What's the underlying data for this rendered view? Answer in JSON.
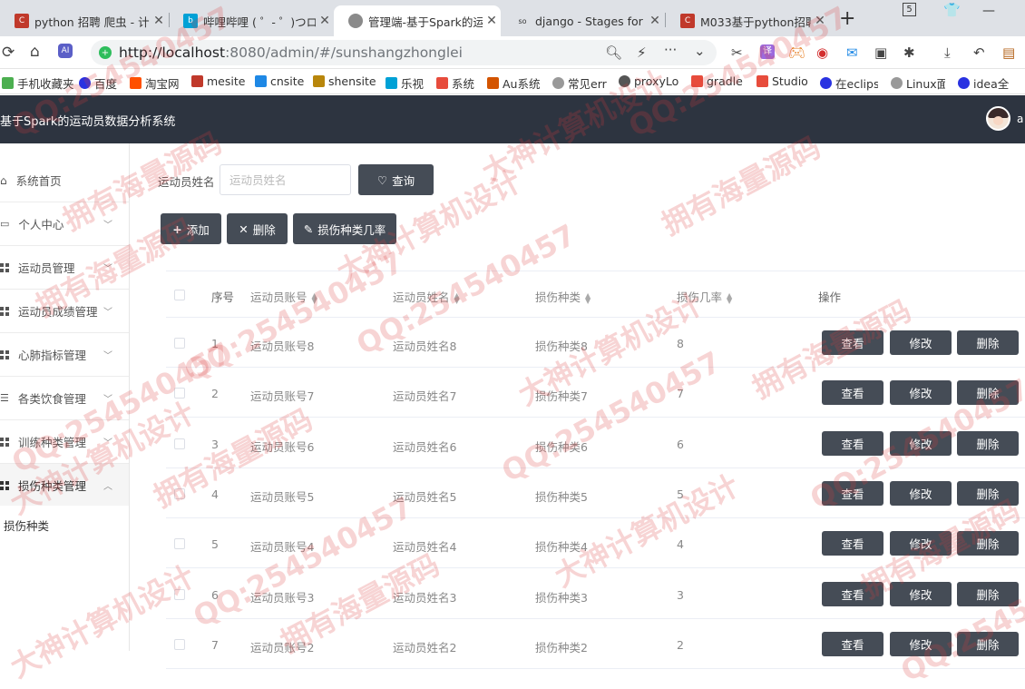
{
  "browser": {
    "tabs": [
      {
        "title": "python 招聘 爬虫 - 计",
        "color": "#c0392b",
        "icon": "csdn-favicon-icon"
      },
      {
        "title": "哔哩哔哩 ( ゜- ゜)つロ",
        "color": "#00a1d6",
        "icon": "bilibili-favicon-icon"
      },
      {
        "title": "管理端-基于Spark的运",
        "color": "#888888",
        "icon": "globe-favicon-icon"
      },
      {
        "title": "django - Stages for /",
        "color": "#333333",
        "icon": "so-favicon-icon"
      },
      {
        "title": "M033基于python招聘",
        "color": "#c0392b",
        "icon": "csdn-favicon-icon"
      }
    ],
    "new_tab_label": "+",
    "window_badge": "5",
    "url_host": "http://localhost",
    "url_path": ":8080/admin/#/sunshangzhonglei",
    "bookmarks": [
      {
        "label": "手机收藏夹",
        "color": "#4caf50"
      },
      {
        "label": "百度",
        "color": "#2932e1"
      },
      {
        "label": "淘宝网",
        "color": "#ff5000"
      },
      {
        "label": "mesite",
        "color": "#c0392b"
      },
      {
        "label": "cnsite",
        "color": "#1e88e5"
      },
      {
        "label": "shensite",
        "color": "#b8860b"
      },
      {
        "label": "乐视",
        "color": "#00a1d6"
      },
      {
        "label": "系统",
        "color": "#e74c3c"
      },
      {
        "label": "Au系统",
        "color": "#d35400"
      },
      {
        "label": "常见err",
        "color": "#999999"
      },
      {
        "label": "proxyLo",
        "color": "#555555"
      },
      {
        "label": "gradle",
        "color": "#e74c3c"
      },
      {
        "label": "Studio",
        "color": "#e74c3c"
      },
      {
        "label": "在eclips",
        "color": "#2932e1"
      },
      {
        "label": "Linux面",
        "color": "#999999"
      },
      {
        "label": "idea全",
        "color": "#2932e1"
      }
    ]
  },
  "app": {
    "title": "基于Spark的运动员数据分析系统",
    "user_initial": "a"
  },
  "sidebar": {
    "items": [
      {
        "label": "系统首页",
        "icon": "home-icon"
      },
      {
        "label": "个人中心",
        "icon": "user-card-icon"
      },
      {
        "label": "运动员管理",
        "icon": "grid-icon"
      },
      {
        "label": "运动员成绩管理",
        "icon": "grid-icon"
      },
      {
        "label": "心肺指标管理",
        "icon": "grid-icon"
      },
      {
        "label": "各类饮食管理",
        "icon": "sliders-icon"
      },
      {
        "label": "训练种类管理",
        "icon": "grid-icon"
      },
      {
        "label": "损伤种类管理",
        "icon": "grid-icon"
      }
    ],
    "submenu": "损伤种类"
  },
  "search": {
    "label": "运动员姓名",
    "placeholder": "运动员姓名",
    "button": "查询"
  },
  "toolbar": {
    "add": "添加",
    "delete": "删除",
    "rate": "损伤种类几率"
  },
  "table": {
    "headers": {
      "index": "序号",
      "account": "运动员账号",
      "name": "运动员姓名",
      "injury": "损伤种类",
      "rate": "损伤几率",
      "ops": "操作"
    },
    "actions": {
      "view": "查看",
      "edit": "修改",
      "delete": "删除"
    },
    "rows": [
      {
        "index": "1",
        "account": "运动员账号8",
        "name": "运动员姓名8",
        "injury": "损伤种类8",
        "rate": "8"
      },
      {
        "index": "2",
        "account": "运动员账号7",
        "name": "运动员姓名7",
        "injury": "损伤种类7",
        "rate": "7"
      },
      {
        "index": "3",
        "account": "运动员账号6",
        "name": "运动员姓名6",
        "injury": "损伤种类6",
        "rate": "6"
      },
      {
        "index": "4",
        "account": "运动员账号5",
        "name": "运动员姓名5",
        "injury": "损伤种类5",
        "rate": "5"
      },
      {
        "index": "5",
        "account": "运动员账号4",
        "name": "运动员姓名4",
        "injury": "损伤种类4",
        "rate": "4"
      },
      {
        "index": "6",
        "account": "运动员账号3",
        "name": "运动员姓名3",
        "injury": "损伤种类3",
        "rate": "3"
      },
      {
        "index": "7",
        "account": "运动员账号2",
        "name": "运动员姓名2",
        "injury": "损伤种类2",
        "rate": "2"
      }
    ]
  },
  "watermarks": [
    "QQ:254540457",
    "拥有海量源码",
    "大神计算机设计"
  ]
}
